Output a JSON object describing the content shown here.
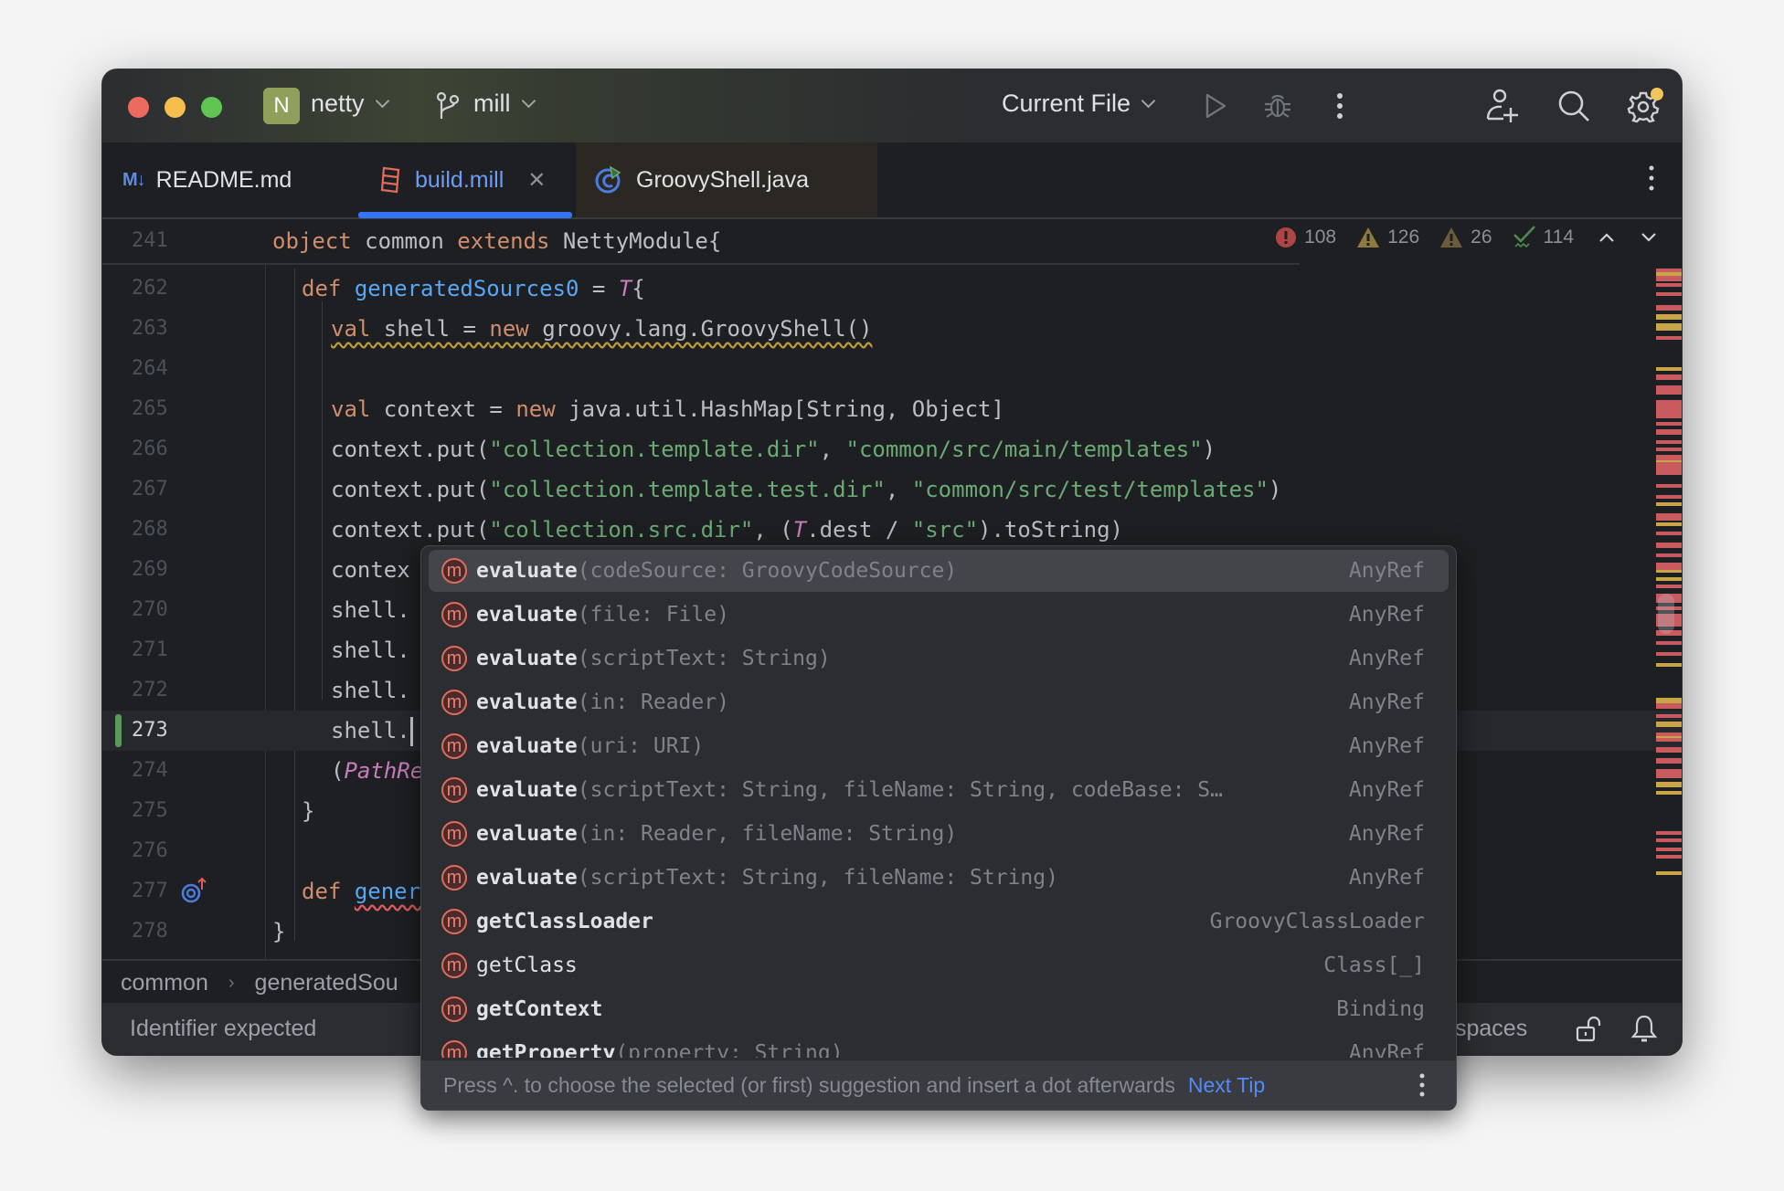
{
  "titlebar": {
    "project_initial": "N",
    "project_name": "netty",
    "branch_name": "mill",
    "run_config": "Current File"
  },
  "colors": {
    "accent": "#3574f0",
    "error": "#db5c5c",
    "warning": "#c9a54a",
    "ok": "#5fa25a",
    "project_badge": "#8fa05a"
  },
  "tabs": [
    {
      "label": "README.md",
      "icon": "markdown-icon",
      "active": false
    },
    {
      "label": "build.mill",
      "icon": "build-file-icon",
      "active": true,
      "closable": true
    },
    {
      "label": "GroovyShell.java",
      "icon": "java-class-icon",
      "active": false
    }
  ],
  "inspections": {
    "errors": "108",
    "warnings": "126",
    "weak_warnings": "26",
    "typos": "114"
  },
  "sticky_line": {
    "number": "241",
    "kw1": "object",
    "name": " common ",
    "kw2": "extends",
    "rest": " NettyModule{"
  },
  "lines": [
    {
      "n": "262"
    },
    {
      "n": "263"
    },
    {
      "n": "264"
    },
    {
      "n": "265"
    },
    {
      "n": "266"
    },
    {
      "n": "267"
    },
    {
      "n": "268"
    },
    {
      "n": "269"
    },
    {
      "n": "270"
    },
    {
      "n": "271"
    },
    {
      "n": "272"
    },
    {
      "n": "273"
    },
    {
      "n": "274"
    },
    {
      "n": "275"
    },
    {
      "n": "276"
    },
    {
      "n": "277"
    },
    {
      "n": "278"
    }
  ],
  "code": {
    "l262": {
      "kw": "def",
      "fn": "generatedSources0",
      "eq": " = ",
      "mac": "T",
      "rest": "{"
    },
    "l263": {
      "kw1": "val",
      "mid": " shell = ",
      "kw2": "new",
      "rest": " groovy.lang.GroovyShell()"
    },
    "l265": {
      "kw1": "val",
      "mid": " context = ",
      "kw2": "new",
      "rest": " java.util.HashMap[String, Object]"
    },
    "l266": {
      "pre": "context.put(",
      "s1": "\"collection.template.dir\"",
      "sep": ", ",
      "s2": "\"common/src/main/templates\"",
      "post": ")"
    },
    "l267": {
      "pre": "context.put(",
      "s1": "\"collection.template.test.dir\"",
      "sep": ", ",
      "s2": "\"common/src/test/templates\"",
      "post": ")"
    },
    "l268": {
      "pre": "context.put(",
      "s1": "\"collection.src.dir\"",
      "sep": ", (",
      "mac": "T",
      "mid": ".dest / ",
      "s2": "\"src\"",
      "post": ").toString)"
    },
    "l269": "contex",
    "l270": "shell.",
    "l271": "shell.",
    "l272": "shell.",
    "l273": "shell.",
    "l274": {
      "pre": "(",
      "mac": "PathRe"
    },
    "l275": "}",
    "l277": {
      "kw": "def",
      "fn": "gener"
    },
    "l278": "}"
  },
  "completion": {
    "items": [
      {
        "name": "evaluate",
        "params": "(codeSource: GroovyCodeSource)",
        "type": "AnyRef",
        "bold": true,
        "selected": true
      },
      {
        "name": "evaluate",
        "params": "(file: File)",
        "type": "AnyRef",
        "bold": true
      },
      {
        "name": "evaluate",
        "params": "(scriptText: String)",
        "type": "AnyRef",
        "bold": true
      },
      {
        "name": "evaluate",
        "params": "(in: Reader)",
        "type": "AnyRef",
        "bold": true
      },
      {
        "name": "evaluate",
        "params": "(uri: URI)",
        "type": "AnyRef",
        "bold": true
      },
      {
        "name": "evaluate",
        "params": "(scriptText: String, fileName: String, codeBase: S…",
        "type": "AnyRef",
        "bold": true
      },
      {
        "name": "evaluate",
        "params": "(in: Reader, fileName: String)",
        "type": "AnyRef",
        "bold": true
      },
      {
        "name": "evaluate",
        "params": "(scriptText: String, fileName: String)",
        "type": "AnyRef",
        "bold": true
      },
      {
        "name": "getClassLoader",
        "params": "",
        "type": "GroovyClassLoader",
        "bold": true
      },
      {
        "name": "getClass",
        "params": "",
        "type": "Class[_]",
        "bold": false
      },
      {
        "name": "getContext",
        "params": "",
        "type": "Binding",
        "bold": true
      },
      {
        "name": "getProperty",
        "params": "(property: String)",
        "type": "AnyRef",
        "bold": true
      }
    ],
    "tip": "Press ^. to choose the selected (or first) suggestion and insert a dot afterwards",
    "next_tip": "Next Tip"
  },
  "breadcrumb": [
    "common",
    "generatedSou"
  ],
  "status": {
    "message": "Identifier expected",
    "indent": "spaces"
  }
}
